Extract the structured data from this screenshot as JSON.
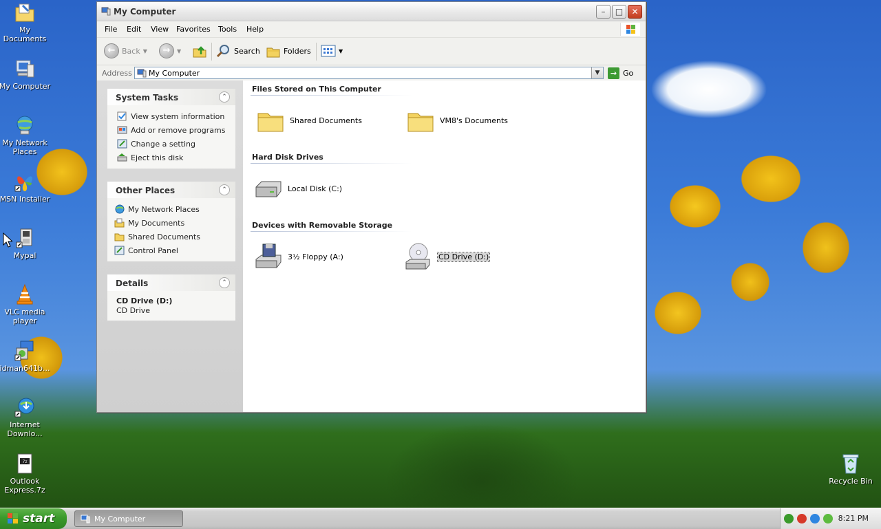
{
  "desktop": {
    "icons": [
      {
        "label": "My Documents"
      },
      {
        "label": "My Computer"
      },
      {
        "label": "My Network Places"
      },
      {
        "label": "MSN Installer"
      },
      {
        "label": "Mypal"
      },
      {
        "label": "VLC media player"
      },
      {
        "label": "idman641b..."
      },
      {
        "label": "Internet Downlo..."
      },
      {
        "label": "Outlook Express.7z"
      },
      {
        "label": "Recycle Bin"
      }
    ]
  },
  "window": {
    "title": "My Computer",
    "menu": [
      "File",
      "Edit",
      "View",
      "Favorites",
      "Tools",
      "Help"
    ],
    "toolbar": {
      "back_label": "Back",
      "search_label": "Search",
      "folders_label": "Folders"
    },
    "address": {
      "label": "Address",
      "value": "My Computer",
      "go_label": "Go"
    },
    "system_tasks": {
      "title": "System Tasks",
      "items": [
        {
          "label": "View system information"
        },
        {
          "label": "Add or remove programs"
        },
        {
          "label": "Change a setting"
        },
        {
          "label": "Eject this disk"
        }
      ]
    },
    "other_places": {
      "title": "Other Places",
      "items": [
        {
          "label": "My Network Places"
        },
        {
          "label": "My Documents"
        },
        {
          "label": "Shared Documents"
        },
        {
          "label": "Control Panel"
        }
      ]
    },
    "details": {
      "title": "Details",
      "name": "CD Drive (D:)",
      "type": "CD Drive"
    },
    "groups": {
      "files_stored": {
        "title": "Files Stored on This Computer",
        "items": [
          {
            "label": "Shared Documents"
          },
          {
            "label": "VM8's Documents"
          }
        ]
      },
      "hard_disks": {
        "title": "Hard Disk Drives",
        "items": [
          {
            "label": "Local Disk (C:)"
          }
        ]
      },
      "removable": {
        "title": "Devices with Removable Storage",
        "items": [
          {
            "label": "3½ Floppy (A:)"
          },
          {
            "label": "CD Drive (D:)"
          }
        ]
      }
    }
  },
  "taskbar": {
    "start_label": "start",
    "window_button_label": "My Computer",
    "clock": "8:21 PM"
  },
  "colors": {
    "start_green": "#3a9a2b",
    "selection_gray": "#d7d7d7"
  }
}
